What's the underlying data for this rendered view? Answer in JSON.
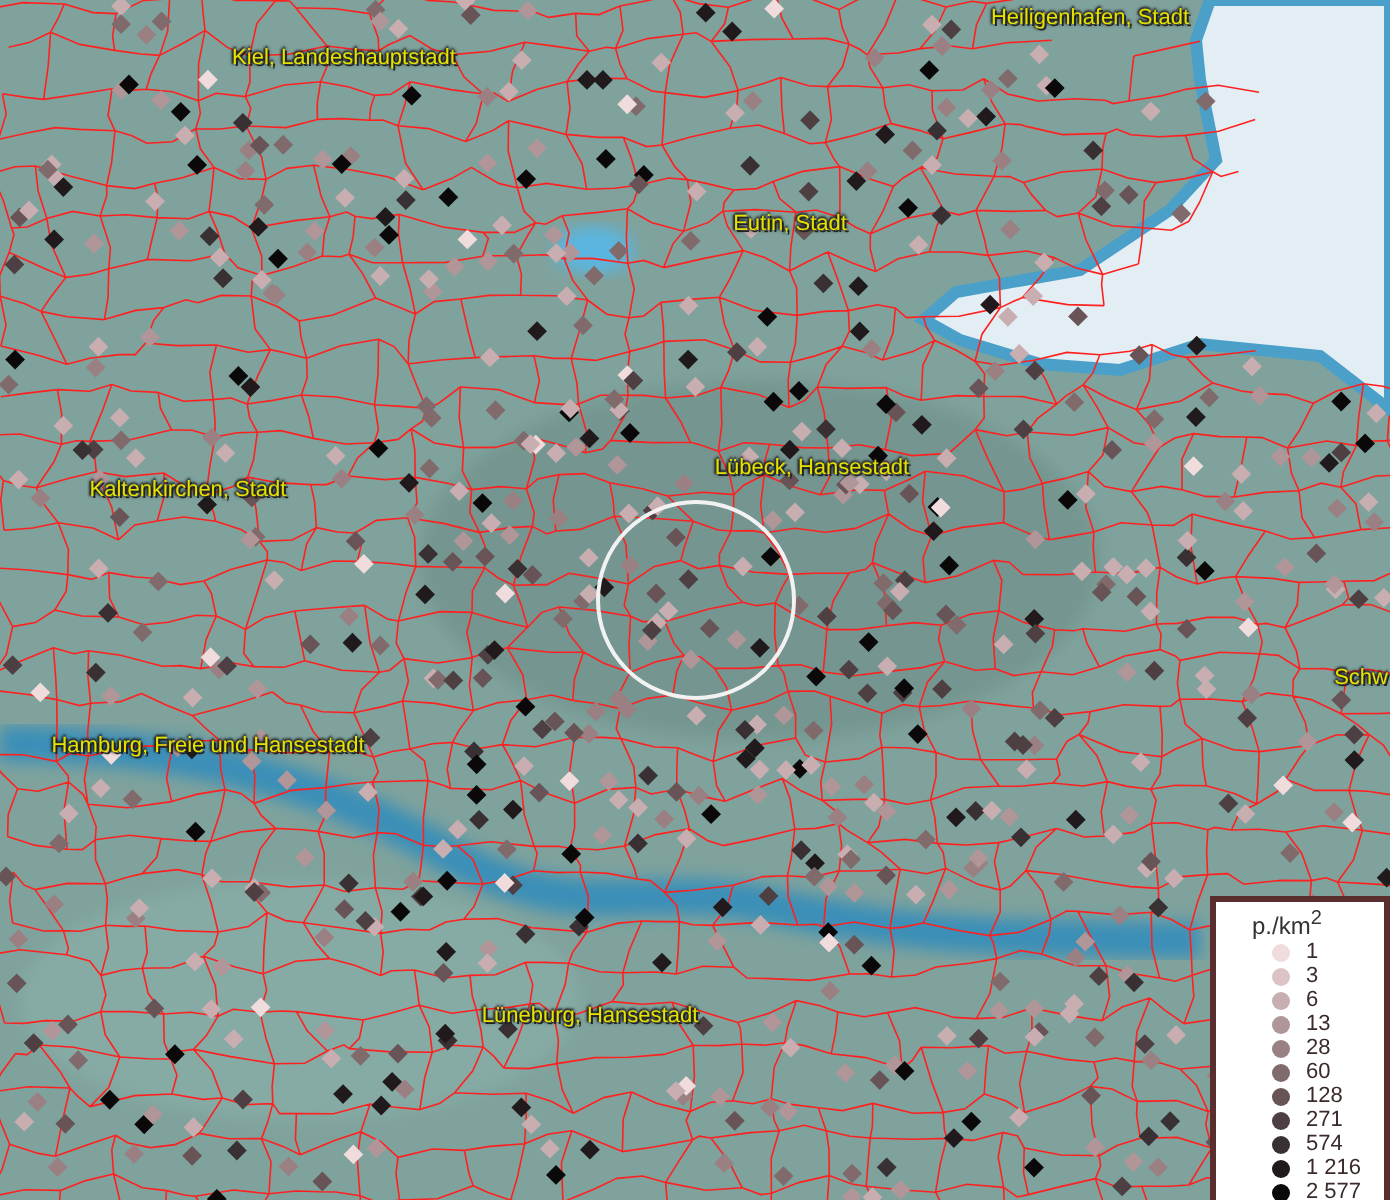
{
  "map": {
    "labels": [
      {
        "text": "Kiel, Landeshauptstadt"
      },
      {
        "text": "Heiligenhafen, Stadt"
      },
      {
        "text": "Eutin, Stadt"
      },
      {
        "text": "Lübeck, Hansestadt"
      },
      {
        "text": "Kaltenkirchen, Stadt"
      },
      {
        "text": "Hamburg, Freie und Hansestadt"
      },
      {
        "text": "Lüneburg, Hansestadt"
      },
      {
        "text": "Schw"
      }
    ]
  },
  "legend": {
    "title": "p./km$^{2}$",
    "items": [
      {
        "label": "1",
        "color": "#f0dcdc"
      },
      {
        "label": "3",
        "color": "#dcc4c6"
      },
      {
        "label": "6",
        "color": "#c8aeb0"
      },
      {
        "label": "13",
        "color": "#b09698"
      },
      {
        "label": "28",
        "color": "#9a8082"
      },
      {
        "label": "60",
        "color": "#806a6c"
      },
      {
        "label": "128",
        "color": "#685456"
      },
      {
        "label": "271",
        "color": "#4e4042"
      },
      {
        "label": "574",
        "color": "#383032"
      },
      {
        "label": "1 216",
        "color": "#201a1c"
      },
      {
        "label": "2 577",
        "color": "#0a0808"
      }
    ]
  }
}
